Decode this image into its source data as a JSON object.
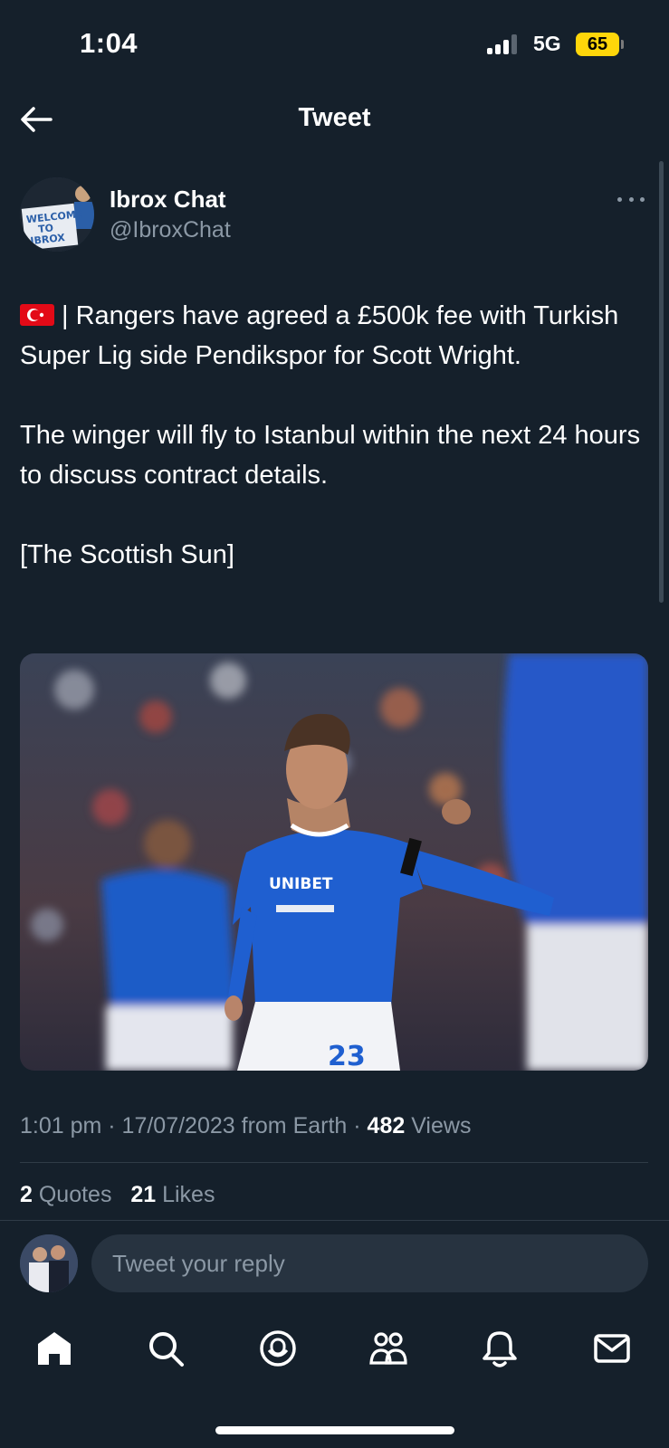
{
  "status_bar": {
    "time": "1:04",
    "network": "5G",
    "battery": "65"
  },
  "header": {
    "title": "Tweet",
    "back_icon": "arrow-left-icon"
  },
  "author": {
    "name": "Ibrox Chat",
    "handle": "@IbroxChat",
    "avatar_sign_text": "WELCOME TO IBROX",
    "more_icon": "more-dots-icon"
  },
  "tweet": {
    "line1": "| Rangers have agreed a £500k fee with Turkish Super Lig side Pendikspor for Scott Wright.",
    "paragraph2": "The winger will fly to Istanbul within the next 24 hours to discuss contract details.",
    "paragraph3": "[The Scottish Sun]",
    "flag_icon": "turkey-flag-icon",
    "image": {
      "sponsor": "UNIBET",
      "shirt_number": "23"
    }
  },
  "meta": {
    "timestamp": "1:01 pm · 17/07/2023 from Earth · ",
    "views_count": "482",
    "views_label": " Views"
  },
  "stats": {
    "quotes_count": "2",
    "quotes_label": "Quotes",
    "likes_count": "21",
    "likes_label": "Likes"
  },
  "reply": {
    "placeholder": "Tweet your reply"
  },
  "nav": [
    "home-icon",
    "search-icon",
    "spaces-icon",
    "communities-icon",
    "notifications-icon",
    "messages-icon"
  ],
  "colors": {
    "background": "#15202b",
    "secondary_text": "#8b98a5",
    "reply_field": "#273340",
    "battery": "#ffd60a"
  }
}
